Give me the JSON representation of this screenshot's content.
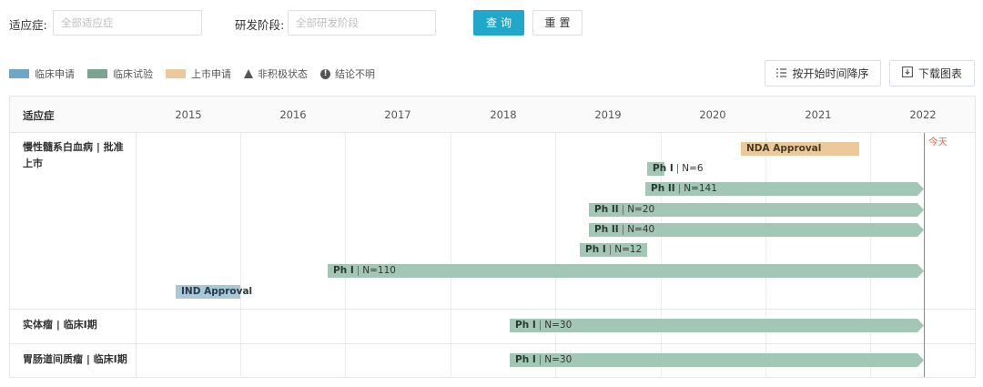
{
  "filters": {
    "indication_label": "适应症:",
    "indication_placeholder": "全部适应症",
    "stage_label": "研发阶段:",
    "stage_placeholder": "全部研发阶段",
    "search_button": "查询",
    "reset_button": "重置"
  },
  "legend": [
    {
      "label": "临床申请",
      "color": "#6fa8c6"
    },
    {
      "label": "临床试验",
      "color": "#7da391"
    },
    {
      "label": "上市申请",
      "color": "#ecc99b"
    },
    {
      "label": "非积极状态",
      "icon": "triangle-icon"
    },
    {
      "label": "结论不明",
      "icon": "alert-icon"
    }
  ],
  "toolbar": {
    "sort_label": "按开始时间降序",
    "sort_icon": "sort-list-icon",
    "download_label": "下载图表",
    "download_icon": "download-chart-icon"
  },
  "table": {
    "indication_header": "适应症",
    "years": [
      "2015",
      "2016",
      "2017",
      "2018",
      "2019",
      "2020",
      "2021",
      "2022"
    ],
    "today_label": "今天",
    "rows": [
      {
        "indication": "慢性髓系白血病 | 批准上市",
        "bars": [
          {
            "kind": "nda",
            "text": "NDA Approval"
          },
          {
            "kind": "trial",
            "phase": "Ph I",
            "n": "N=6"
          },
          {
            "kind": "trial",
            "phase": "Ph II",
            "n": "N=141"
          },
          {
            "kind": "trial",
            "phase": "Ph II",
            "n": "N=20"
          },
          {
            "kind": "trial",
            "phase": "Ph II",
            "n": "N=40"
          },
          {
            "kind": "trial",
            "phase": "Ph I",
            "n": "N=12"
          },
          {
            "kind": "trial",
            "phase": "Ph I",
            "n": "N=110"
          },
          {
            "kind": "ind",
            "text": "IND Approval"
          }
        ]
      },
      {
        "indication": "实体瘤 | 临床I期",
        "bars": [
          {
            "kind": "trial",
            "phase": "Ph I",
            "n": "N=30"
          }
        ]
      },
      {
        "indication": "胃肠道间质瘤 | 临床I期",
        "bars": [
          {
            "kind": "trial",
            "phase": "Ph I",
            "n": "N=30"
          }
        ]
      }
    ]
  }
}
